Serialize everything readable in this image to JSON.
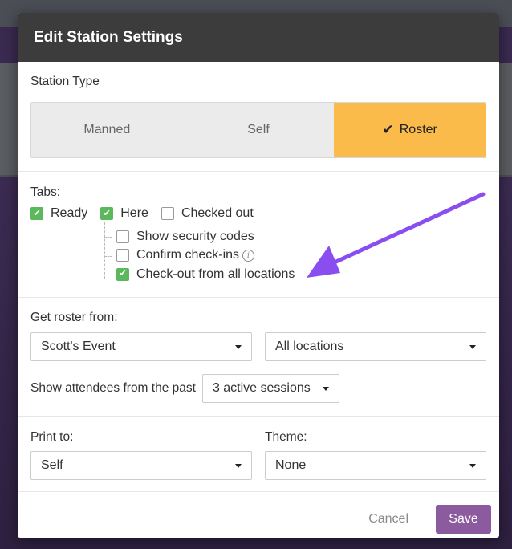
{
  "modal": {
    "title": "Edit Station Settings"
  },
  "station_type": {
    "label": "Station Type",
    "options": [
      {
        "label": "Manned",
        "active": false
      },
      {
        "label": "Self",
        "active": false
      },
      {
        "label": "Roster",
        "active": true
      }
    ],
    "active_icon": "check-icon"
  },
  "tabs": {
    "label": "Tabs:",
    "items": [
      {
        "label": "Ready",
        "checked": true
      },
      {
        "label": "Here",
        "checked": true
      },
      {
        "label": "Checked out",
        "checked": false
      }
    ],
    "sub_options": [
      {
        "label": "Show security codes",
        "checked": false
      },
      {
        "label": "Confirm check-ins",
        "checked": false,
        "icon": "info-icon"
      },
      {
        "label": "Check-out from all locations",
        "checked": true
      }
    ],
    "annotation_arrow_color": "#8a4ef0"
  },
  "roster": {
    "label": "Get roster from:",
    "event_select": "Scott's Event",
    "location_select": "All locations",
    "past_label": "Show attendees from the past",
    "past_select": "3 active sessions"
  },
  "print": {
    "print_label": "Print to:",
    "print_select": "Self",
    "theme_label": "Theme:",
    "theme_select": "None"
  },
  "footer": {
    "cancel_label": "Cancel",
    "save_label": "Save"
  },
  "colors": {
    "header_bg": "#3c3c3c",
    "active_segment": "#fbbb4a",
    "checkbox_checked": "#5cb85c",
    "save_button": "#8c5a9f"
  }
}
